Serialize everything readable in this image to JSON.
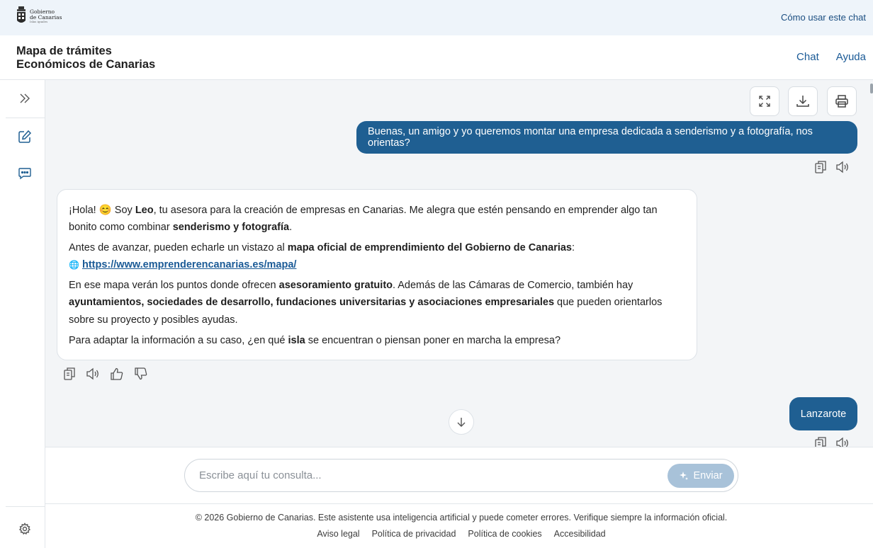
{
  "topbar": {
    "logo_line1": "Gobierno",
    "logo_line2": "de Canarias",
    "logo_line3": "Islas iguales",
    "howto_label": "Cómo usar este chat"
  },
  "header": {
    "title_line1": "Mapa de trámites",
    "title_line2": "Económicos de Canarias",
    "nav": {
      "chat": "Chat",
      "help": "Ayuda"
    }
  },
  "sidebar": {
    "icons": [
      "expand-icon",
      "new-chat-icon",
      "chat-history-icon",
      "settings-icon"
    ]
  },
  "toolbar": {
    "icons": [
      "fullscreen-icon",
      "download-icon",
      "print-icon"
    ]
  },
  "messages": {
    "user1": "Buenas, un amigo y yo queremos montar una empresa dedicada a senderismo y a fotografía, nos orientas?",
    "bot": {
      "p1_a": "¡Hola! 😊 Soy ",
      "p1_b": "Leo",
      "p1_c": ", tu asesora para la creación de empresas en Canarias. Me alegra que estén pensando en emprender algo tan bonito como combinar ",
      "p1_d": "senderismo y fotografía",
      "p1_e": ".",
      "p2_a": "Antes de avanzar, pueden echarle un vistazo al ",
      "p2_b": "mapa oficial de emprendimiento del Gobierno de Canarias",
      "p2_c": ":",
      "link_emoji": "🌐",
      "link": "https://www.emprenderencanarias.es/mapa/",
      "p3_a": "En ese mapa verán los puntos donde ofrecen ",
      "p3_b": "asesoramiento gratuito",
      "p3_c": ". Además de las Cámaras de Comercio, también hay ",
      "p3_d": "ayuntamientos, sociedades de desarrollo, fundaciones universitarias y asociaciones empresariales",
      "p3_e": " que pueden orientarlos sobre su proyecto y posibles ayudas.",
      "p4_a": "Para adaptar la información a su caso, ¿en qué ",
      "p4_b": "isla",
      "p4_c": " se encuentran o piensan poner en marcha la empresa?"
    },
    "user2": "Lanzarote"
  },
  "composer": {
    "placeholder": "Escribe aquí tu consulta...",
    "send_label": "Enviar"
  },
  "footer": {
    "note": "© 2026 Gobierno de Canarias. Este asistente usa inteligencia artificial y puede cometer errores. Verifique siempre la información oficial.",
    "links": [
      "Aviso legal",
      "Política de privacidad",
      "Política de cookies",
      "Accesibilidad"
    ]
  }
}
